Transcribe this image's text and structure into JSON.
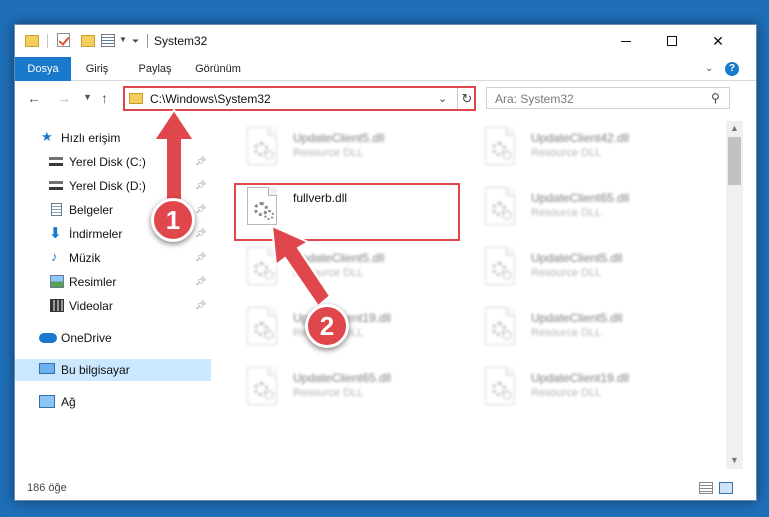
{
  "window": {
    "title": "System32"
  },
  "ribbon": {
    "tabs": [
      "Dosya",
      "Giriş",
      "Paylaş",
      "Görünüm"
    ]
  },
  "nav": {
    "address": "C:\\Windows\\System32",
    "search_placeholder": "Ara: System32"
  },
  "sidebar": {
    "items": [
      {
        "label": "Hızlı erişim",
        "icon": "star-icon"
      },
      {
        "label": "Yerel Disk (C:)",
        "icon": "disk-icon",
        "pinned": true
      },
      {
        "label": "Yerel Disk (D:)",
        "icon": "disk-icon",
        "pinned": true
      },
      {
        "label": "Belgeler",
        "icon": "documents-icon",
        "pinned": true
      },
      {
        "label": "İndirmeler",
        "icon": "downloads-icon",
        "pinned": true
      },
      {
        "label": "Müzik",
        "icon": "music-icon",
        "pinned": true
      },
      {
        "label": "Resimler",
        "icon": "pictures-icon",
        "pinned": true
      },
      {
        "label": "Videolar",
        "icon": "videos-icon",
        "pinned": true
      },
      {
        "label": "OneDrive",
        "icon": "onedrive-icon"
      },
      {
        "label": "Bu bilgisayar",
        "icon": "this-pc-icon",
        "selected": true
      },
      {
        "label": "Ağ",
        "icon": "network-icon"
      }
    ]
  },
  "files": [
    {
      "name": "UpdateClient5.dll",
      "type": "Resource DLL"
    },
    {
      "name": "UpdateClient42.dll",
      "type": "Resource DLL"
    },
    {
      "name": "fullverb.dll",
      "type": "",
      "highlighted": true
    },
    {
      "name": "UpdateClient65.dll",
      "type": "Resource DLL"
    },
    {
      "name": "UpdateClient5.dll",
      "type": "Resource DLL"
    },
    {
      "name": "UpdateClient5.dll",
      "type": "Resource DLL"
    },
    {
      "name": "UpdateClient19.dll",
      "type": "Resource DLL"
    },
    {
      "name": "UpdateClient5.dll",
      "type": "Resource DLL"
    },
    {
      "name": "UpdateClient65.dll",
      "type": "Resource DLL"
    },
    {
      "name": "UpdateClient19.dll",
      "type": "Resource DLL"
    }
  ],
  "status": {
    "item_count": "186 öğe"
  },
  "annotations": {
    "step1": "1",
    "step2": "2"
  },
  "colors": {
    "accent": "#1979ca",
    "highlight": "#e0474c",
    "desktop": "#1e6fb8"
  }
}
